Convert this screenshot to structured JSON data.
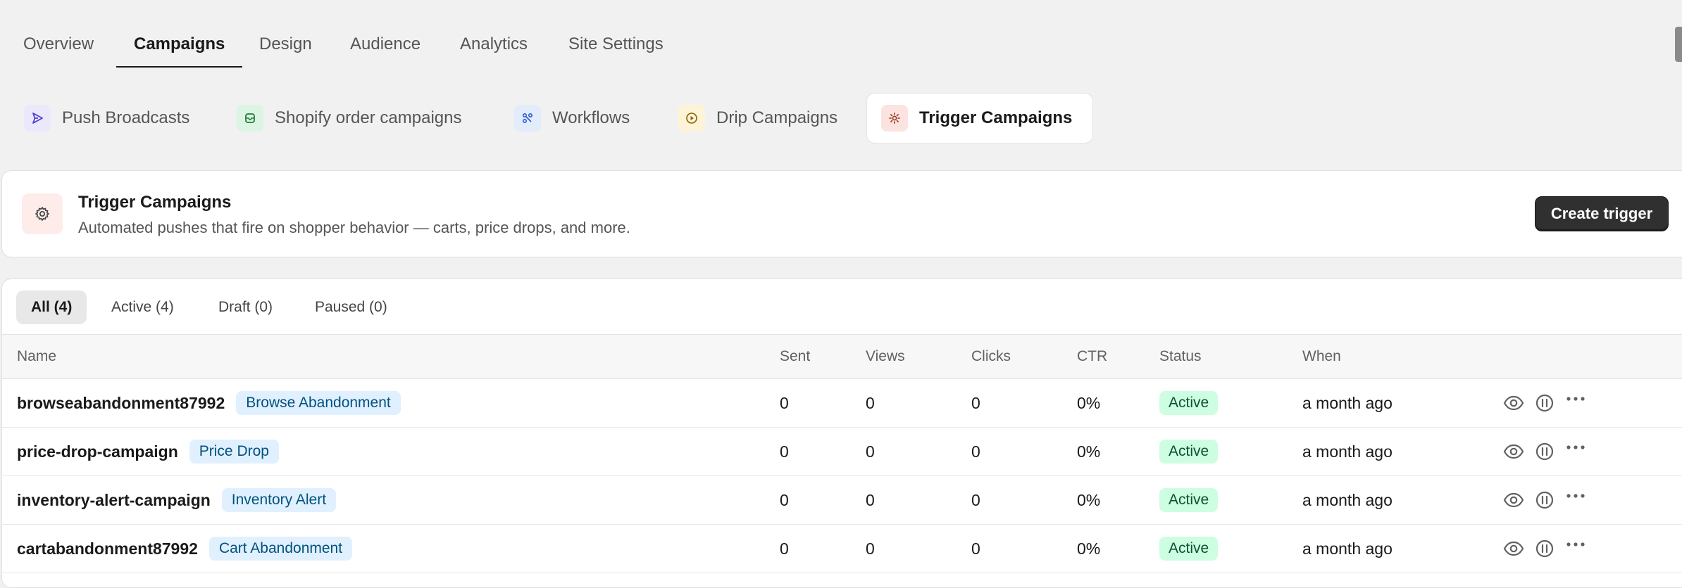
{
  "top_tabs": [
    {
      "label": "Overview"
    },
    {
      "label": "Campaigns"
    },
    {
      "label": "Design"
    },
    {
      "label": "Audience"
    },
    {
      "label": "Analytics"
    },
    {
      "label": "Site Settings"
    }
  ],
  "active_top_tab": "Campaigns",
  "sub_tabs": [
    {
      "label": "Push Broadcasts",
      "icon": "send-icon",
      "icon_bg": "#ebe8fb",
      "icon_color": "#4b3fcf"
    },
    {
      "label": "Shopify order campaigns",
      "icon": "order-icon",
      "icon_bg": "#dcf5e3",
      "icon_color": "#1f7a3d"
    },
    {
      "label": "Workflows",
      "icon": "workflow-icon",
      "icon_bg": "#e2ecfb",
      "icon_color": "#2a5bd7"
    },
    {
      "label": "Drip Campaigns",
      "icon": "play-circle-icon",
      "icon_bg": "#fdf3d6",
      "icon_color": "#8a6100"
    },
    {
      "label": "Trigger Campaigns",
      "icon": "gear-icon",
      "icon_bg": "#fbe4df",
      "icon_color": "#9a3b23"
    }
  ],
  "active_sub_tab": "Trigger Campaigns",
  "header": {
    "title": "Trigger Campaigns",
    "description": "Automated pushes that fire on shopper behavior — carts, price drops, and more.",
    "create_button": "Create trigger",
    "icon": "gear-icon"
  },
  "filters": [
    {
      "label": "All (4)"
    },
    {
      "label": "Active (4)"
    },
    {
      "label": "Draft (0)"
    },
    {
      "label": "Paused (0)"
    }
  ],
  "active_filter": "All (4)",
  "table": {
    "columns": [
      "Name",
      "Sent",
      "Views",
      "Clicks",
      "CTR",
      "Status",
      "When"
    ],
    "rows": [
      {
        "name": "browseabandonment87992",
        "type": "Browse Abandonment",
        "sent": "0",
        "views": "0",
        "clicks": "0",
        "ctr": "0%",
        "status": "Active",
        "when": "a month ago"
      },
      {
        "name": "price-drop-campaign",
        "type": "Price Drop",
        "sent": "0",
        "views": "0",
        "clicks": "0",
        "ctr": "0%",
        "status": "Active",
        "when": "a month ago"
      },
      {
        "name": "inventory-alert-campaign",
        "type": "Inventory Alert",
        "sent": "0",
        "views": "0",
        "clicks": "0",
        "ctr": "0%",
        "status": "Active",
        "when": "a month ago"
      },
      {
        "name": "cartabandonment87992",
        "type": "Cart Abandonment",
        "sent": "0",
        "views": "0",
        "clicks": "0",
        "ctr": "0%",
        "status": "Active",
        "when": "a month ago"
      }
    ],
    "row_actions": [
      "eye-icon",
      "pause-circle-icon",
      "more-horizontal-icon"
    ]
  },
  "colors": {
    "accent_dark": "#303030",
    "badge_blue_bg": "#e0f0ff",
    "badge_green_bg": "#cdfee1"
  }
}
